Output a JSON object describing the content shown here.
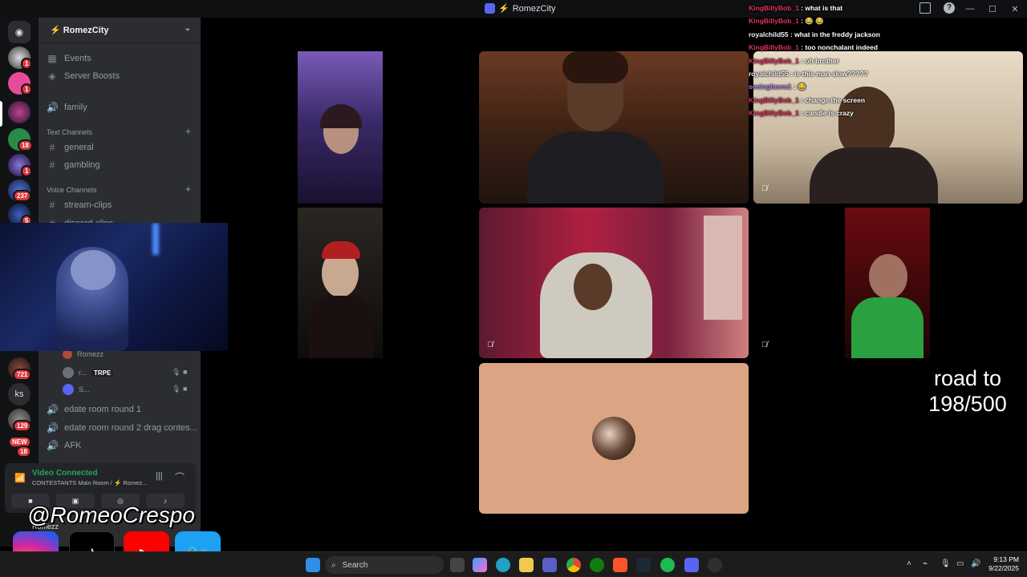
{
  "window": {
    "title": "RomezCity"
  },
  "guild": {
    "name": "RomezCity"
  },
  "sidebar": {
    "top_items": [
      {
        "icon": "calendar-icon",
        "label": "Events"
      },
      {
        "icon": "boost-icon",
        "label": "Server Boosts"
      },
      {
        "icon": "voice-icon",
        "label": "family"
      }
    ],
    "text_category": "Text Channels",
    "text_channels": [
      "general",
      "gambling"
    ],
    "voice_category": "Voice Channels",
    "voice_channels": [
      "stream-clips",
      "discord-clips"
    ],
    "voice_members": [
      {
        "name": "Romezz",
        "tag": ""
      },
      {
        "name": "r...",
        "tag": "TRPE"
      },
      {
        "name": "S...",
        "tag": ""
      }
    ],
    "lower_channels": [
      "edate room round 1",
      "edate room round 2 drag contes...",
      "AFK"
    ]
  },
  "server_badges": [
    "1",
    "1",
    "18",
    "1",
    "237",
    "5",
    "721",
    "129",
    "NEW",
    "18"
  ],
  "server_text_icon": "ks",
  "rtc": {
    "status": "Video Connected",
    "location": "CONTESTANTS Main Room / ⚡ Romez...",
    "username": "Romezz"
  },
  "chat": [
    {
      "user": "KingBillyBob_1",
      "msg": "what is that",
      "color": "#e0345a"
    },
    {
      "user": "KingBillyBob_1",
      "msg": "😂 😂",
      "color": "#e0345a"
    },
    {
      "user": "royalchild55",
      "msg": "what in the freddy jackson",
      "color": "#f2f3f5"
    },
    {
      "user": "KingBillyBob_1",
      "msg": "too nonchalant indeed",
      "color": "#e0345a"
    },
    {
      "user": "KingBillyBob_1",
      "msg": "oh brother",
      "color": "#e0345a"
    },
    {
      "user": "royalchild55",
      "msg": "is this man slow?????",
      "color": "#f2f3f5"
    },
    {
      "user": "seeingfaces1",
      "msg": "😂",
      "color": "#a78ae6"
    },
    {
      "user": "KingBillyBob_1",
      "msg": "change the screen",
      "color": "#e0345a"
    },
    {
      "user": "KingBillyBob_1",
      "msg": "candle is crazy",
      "color": "#e0345a"
    }
  ],
  "overlay": {
    "road_line1": "road to",
    "road_line2": "198/500",
    "handle": "@RomeoCrespo"
  },
  "taskbar": {
    "search_placeholder": "Search",
    "time": "9:13 PM",
    "date": "9/22/2025"
  }
}
